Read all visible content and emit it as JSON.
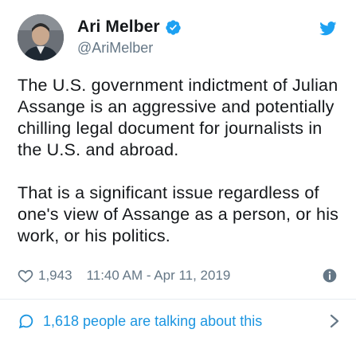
{
  "author": {
    "display_name": "Ari Melber",
    "handle": "@AriMelber",
    "avatar_icon": "avatar-photo",
    "verified_icon": "verified-badge-icon"
  },
  "tweet": {
    "paragraphs": [
      "The U.S. government indictment of Julian Assange is an aggressive and potentially chilling legal document for journalists in the U.S. and abroad.",
      "That is a significant issue regardless of one's view of Assange as a person, or his work, or his politics."
    ]
  },
  "meta": {
    "likes": "1,943",
    "timestamp": "11:40 AM - Apr 11, 2019"
  },
  "footer": {
    "talking_text": "1,618 people are talking about this"
  },
  "colors": {
    "text": "#14171a",
    "secondary": "#657786",
    "accent": "#1da1f2",
    "link": "#1b95e0",
    "divider": "#e6ecf0"
  }
}
